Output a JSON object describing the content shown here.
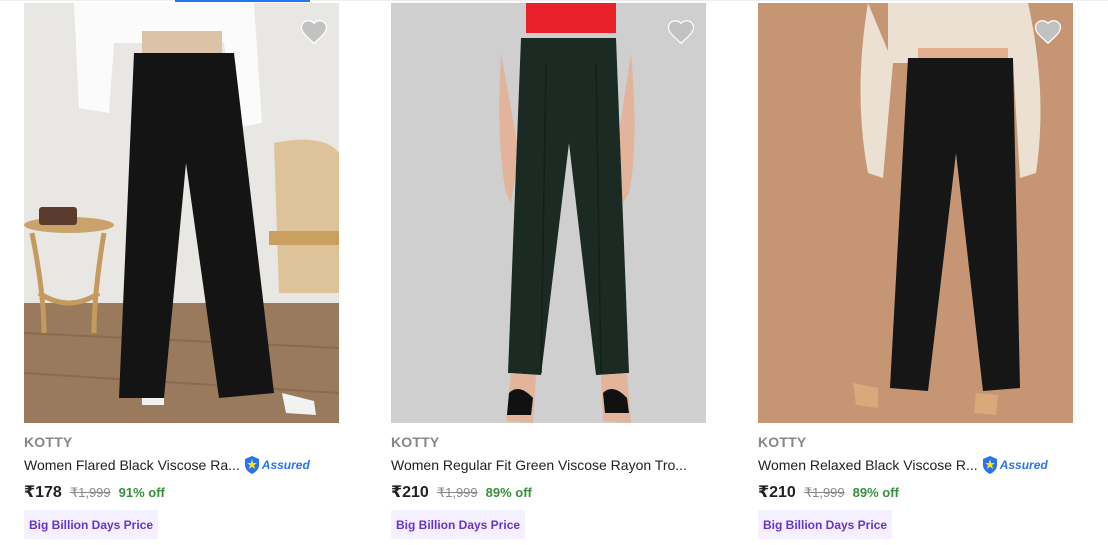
{
  "colors": {
    "accent": "#2874f0",
    "brand_gray": "#878787",
    "discount_green": "#388e3c",
    "badge_bg": "#f5f0ff",
    "badge_text": "#6a32c9"
  },
  "products": [
    {
      "brand": "KOTTY",
      "title": "Women Flared Black Viscose Ra...",
      "assured": "Assured",
      "price": "₹178",
      "mrp": "₹1,999",
      "discount": "91% off",
      "badge": "Big Billion Days Price",
      "wishlist_icon": "heart-icon"
    },
    {
      "brand": "KOTTY",
      "title": "Women Regular Fit Green Viscose Rayon Tro...",
      "price": "₹210",
      "mrp": "₹1,999",
      "discount": "89% off",
      "badge": "Big Billion Days Price",
      "wishlist_icon": "heart-icon"
    },
    {
      "brand": "KOTTY",
      "title": "Women Relaxed Black Viscose R...",
      "assured": "Assured",
      "price": "₹210",
      "mrp": "₹1,999",
      "discount": "89% off",
      "badge": "Big Billion Days Price",
      "wishlist_icon": "heart-icon"
    }
  ]
}
